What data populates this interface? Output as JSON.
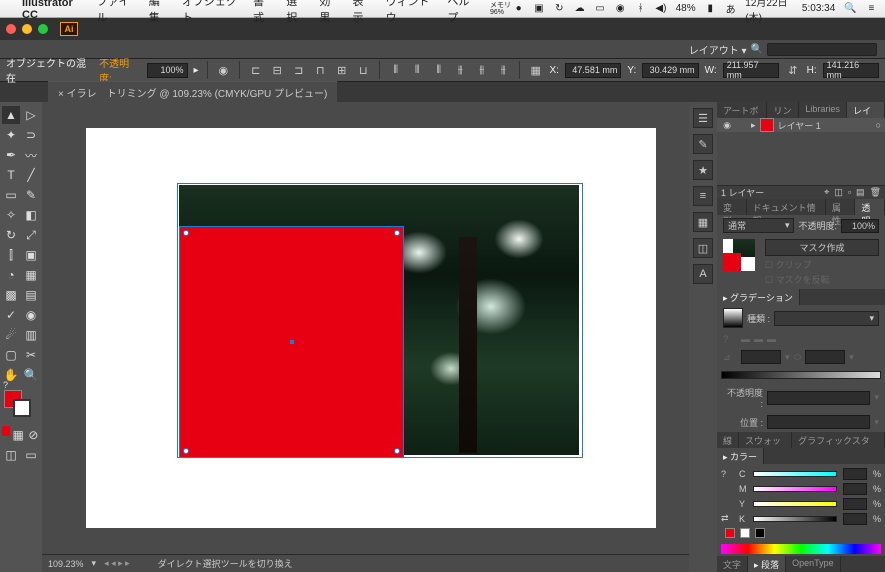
{
  "menubar": {
    "apple": "",
    "app": "Illustrator CC",
    "items": [
      "ファイル",
      "編集",
      "オブジェクト",
      "書式",
      "選択",
      "効果",
      "表示",
      "ウィンドウ",
      "ヘルプ"
    ],
    "right": {
      "memory": "メモリ\n96%",
      "battery": "48%",
      "date": "12月22日(木)",
      "time": "5:03:34"
    }
  },
  "wsrow": {
    "label": "レイアウト ▾"
  },
  "ctrlbar": {
    "label": "オブジェクトの混在",
    "opacity_lbl": "不透明度:",
    "opacity": "100%",
    "x_lbl": "X:",
    "x": "47.581 mm",
    "y_lbl": "Y:",
    "y": "30.429 mm",
    "w_lbl": "W:",
    "w": "211.957 mm",
    "h_lbl": "H:",
    "h": "141.216 mm"
  },
  "doctab": {
    "title": "× イラレ　トリミング @ 109.23% (CMYK/GPU プレビュー)"
  },
  "statusbar": {
    "zoom": "109.23%",
    "hint": "ダイレクト選択ツールを切り換え"
  },
  "panels": {
    "layer_tabs": [
      "アートボード",
      "リンク",
      "Libraries",
      "レイヤー"
    ],
    "layer_name": "レイヤー 1",
    "layers_count": "1 レイヤー",
    "appearance_tabs": [
      "変形",
      "ドキュメント情報",
      "属性",
      "透明"
    ],
    "blend": "通常",
    "p_opacity_lbl": "不透明度:",
    "p_opacity": "100%",
    "mask_btn": "マスク作成",
    "clip": "クリップ",
    "invert": "マスクを反転",
    "grad_title": "グラデーション",
    "grad_type_lbl": "種類 :",
    "g_opacity_lbl": "不透明度 :",
    "g_loc_lbl": "位置 :",
    "swatch_tabs": [
      "線",
      "スウォッチ",
      "グラフィックスタイル"
    ],
    "color_title": "カラー",
    "c": "C",
    "m": "M",
    "y": "Y",
    "k": "K",
    "pct": "%",
    "bottom_tabs": [
      "文字",
      "段落",
      "OpenType"
    ]
  }
}
